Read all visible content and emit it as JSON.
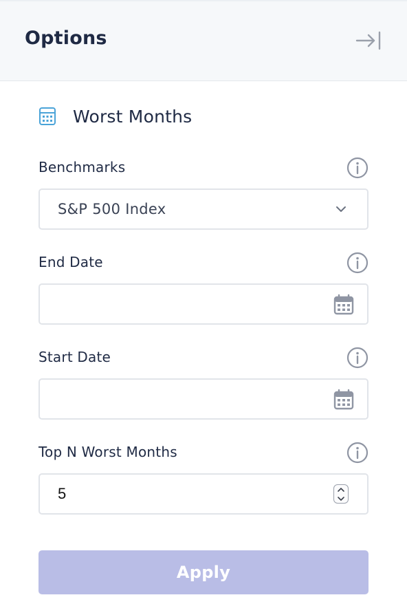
{
  "header": {
    "title": "Options",
    "collapse_icon": "collapse-right-icon"
  },
  "section": {
    "title": "Worst Months",
    "icon": "calculator-icon"
  },
  "fields": {
    "benchmarks": {
      "label": "Benchmarks",
      "value": "S&P 500 Index",
      "icon": "chevron-down-icon"
    },
    "end_date": {
      "label": "End Date",
      "value": "",
      "icon": "calendar-icon"
    },
    "start_date": {
      "label": "Start Date",
      "value": "",
      "icon": "calendar-icon"
    },
    "top_n": {
      "label": "Top N Worst Months",
      "value": "5"
    }
  },
  "apply_label": "Apply",
  "colors": {
    "header_bg": "#f6f8fa",
    "text": "#1f2a44",
    "accent_icon": "#4aa3d8",
    "apply_disabled": "#b9bde6"
  }
}
